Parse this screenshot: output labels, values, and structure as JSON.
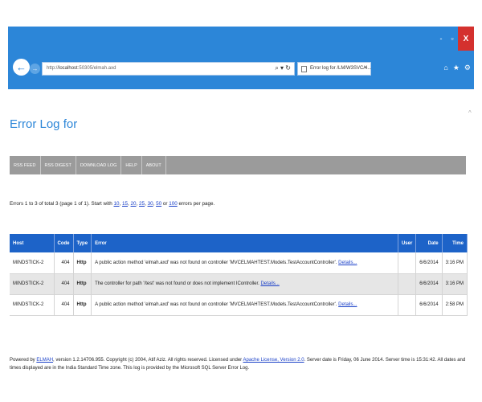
{
  "browser": {
    "window_controls": {
      "minimize": "-",
      "restore": "▫",
      "close": "X"
    },
    "address": {
      "prefix": "http://",
      "host": "localhost",
      "rest": ":50305/elmah.axd"
    },
    "address_tools": "⌕ ▾ ↻",
    "tab_title": "Error log for /LM/W3SVC/4...",
    "tab_close": "×",
    "toolbar_icons": {
      "home": "⌂",
      "favorites": "★",
      "settings": "⚙"
    },
    "colors": {
      "chrome": "#2c86d8",
      "close": "#d4312e"
    }
  },
  "page": {
    "title": "Error Log for",
    "menu": [
      "RSS FEED",
      "RSS DIGEST",
      "DOWNLOAD LOG",
      "HELP",
      "ABOUT"
    ],
    "summary": {
      "prefix": "Errors 1 to 3 of total 3 (page 1 of 1). Start with ",
      "sizes": [
        "10",
        "15",
        "20",
        "25",
        "30",
        "50",
        "100"
      ],
      "sep": ", ",
      "or": " or ",
      "suffix": " errors per page."
    },
    "table": {
      "headers": {
        "host": "Host",
        "code": "Code",
        "type": "Type",
        "error": "Error",
        "user": "User",
        "date": "Date",
        "time": "Time"
      },
      "details_label": "Details...",
      "rows": [
        {
          "host": "MINDSTICK-2",
          "code": "404",
          "type": "Http",
          "error": "A public action method 'elmah.axd' was not found on controller 'MVCELMAHTEST.Models.TestAccountController'.",
          "user": "",
          "date": "6/6/2014",
          "time": "3:16 PM"
        },
        {
          "host": "MINDSTICK-2",
          "code": "404",
          "type": "Http",
          "error": "The controller for path '/test' was not found or does not implement IController.",
          "user": "",
          "date": "6/6/2014",
          "time": "3:16 PM"
        },
        {
          "host": "MINDSTICK-2",
          "code": "404",
          "type": "Http",
          "error": "A public action method 'elmah.axd' was not found on controller 'MVCELMAHTEST.Models.TestAccountController'.",
          "user": "",
          "date": "6/6/2014",
          "time": "2:58 PM"
        }
      ]
    },
    "footer": {
      "p1": "Powered by ",
      "elmah": "ELMAH",
      "p2": ", version 1.2.14706.955. Copyright (c) 2004, Atif Aziz. All rights reserved. Licensed under ",
      "license": "Apache License, Version 2.0",
      "p3": ". Server date is Friday, 06 June 2014. Server time is 15:31:42. All dates and times displayed are in the India Standard Time zone. This log is provided by the Microsoft SQL Server Error Log."
    }
  }
}
